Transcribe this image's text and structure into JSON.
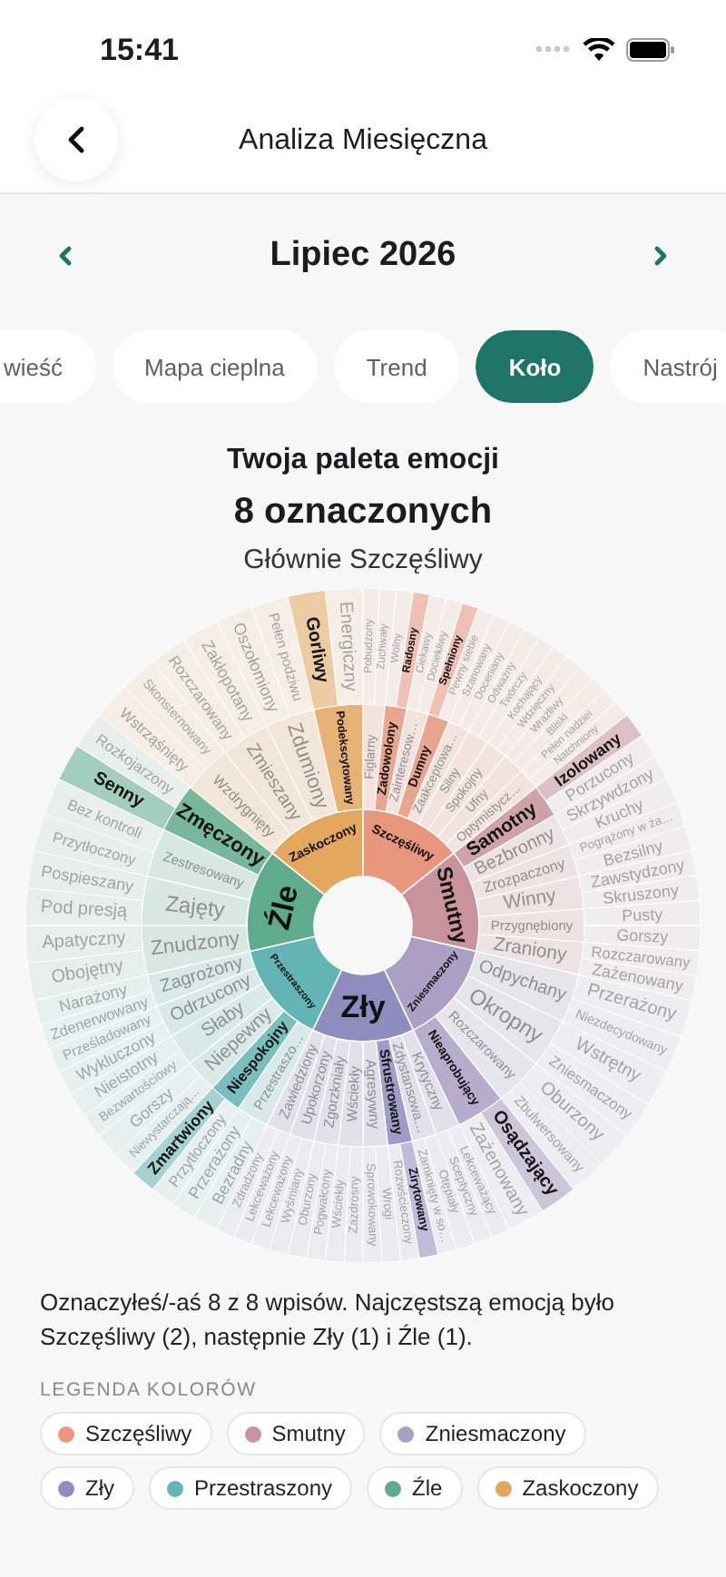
{
  "status_bar": {
    "time": "15:41"
  },
  "header": {
    "title": "Analiza Miesięczna"
  },
  "month": {
    "label": "Lipiec 2026"
  },
  "tabs": [
    {
      "label": "wieść",
      "selected": false
    },
    {
      "label": "Mapa cieplna",
      "selected": false
    },
    {
      "label": "Trend",
      "selected": false
    },
    {
      "label": "Koło",
      "selected": true
    },
    {
      "label": "Nastrój",
      "selected": false
    }
  ],
  "palette": {
    "title": "Twoja paleta emocji",
    "count": "8 oznaczonych",
    "subtitle": "Głównie Szczęśliwy"
  },
  "wheel": {
    "emotions": [
      {
        "name": "Zaskoczony",
        "color": "#e3a75e",
        "children": [
          {
            "name": "Wzdrygnięty",
            "highlighted": false,
            "children": [
              {
                "name": "Wstrząśnięty",
                "highlighted": false
              },
              {
                "name": "Skonsternowany",
                "highlighted": false
              }
            ]
          },
          {
            "name": "Zmieszany",
            "highlighted": false,
            "children": [
              {
                "name": "Rozczarowany",
                "highlighted": false
              },
              {
                "name": "Zakłopotany",
                "highlighted": false
              }
            ]
          },
          {
            "name": "Zdumiony",
            "highlighted": false,
            "children": [
              {
                "name": "Oszołomiony",
                "highlighted": false
              },
              {
                "name": "Pełen podziwu",
                "highlighted": false
              }
            ]
          },
          {
            "name": "Podekscytowany",
            "highlighted": true,
            "children": [
              {
                "name": "Gorliwy",
                "highlighted": true
              },
              {
                "name": "Energiczny",
                "highlighted": false
              }
            ]
          }
        ]
      },
      {
        "name": "Szczęśliwy",
        "color": "#e8967c",
        "children": [
          {
            "name": "Figlarny",
            "highlighted": false,
            "children": [
              {
                "name": "Pobudzony",
                "highlighted": false
              },
              {
                "name": "Zuchwały",
                "highlighted": false
              }
            ]
          },
          {
            "name": "Zadowolony",
            "highlighted": true,
            "children": [
              {
                "name": "Wolny",
                "highlighted": false
              },
              {
                "name": "Radosny",
                "highlighted": true
              }
            ]
          },
          {
            "name": "Zainteresow…",
            "highlighted": false,
            "children": [
              {
                "name": "Ciekawy",
                "highlighted": false
              },
              {
                "name": "Dociekliwy",
                "highlighted": false
              }
            ]
          },
          {
            "name": "Dumny",
            "highlighted": true,
            "children": [
              {
                "name": "Spełniony",
                "highlighted": true
              },
              {
                "name": "Pewny siebie",
                "highlighted": false
              }
            ]
          },
          {
            "name": "Zaakceptowa…",
            "highlighted": false,
            "children": [
              {
                "name": "Szanowany",
                "highlighted": false
              },
              {
                "name": "Doceniany",
                "highlighted": false
              }
            ]
          },
          {
            "name": "Silny",
            "highlighted": false,
            "children": [
              {
                "name": "Odważny",
                "highlighted": false
              },
              {
                "name": "Twórczy",
                "highlighted": false
              }
            ]
          },
          {
            "name": "Spokojny",
            "highlighted": false,
            "children": [
              {
                "name": "Kochający",
                "highlighted": false
              },
              {
                "name": "Wdzięczny",
                "highlighted": false
              }
            ]
          },
          {
            "name": "Ufny",
            "highlighted": false,
            "children": [
              {
                "name": "Wrażliwy",
                "highlighted": false
              },
              {
                "name": "Bliski",
                "highlighted": false
              }
            ]
          },
          {
            "name": "Optymistycz…",
            "highlighted": false,
            "children": [
              {
                "name": "Pełen nadziei",
                "highlighted": false
              },
              {
                "name": "Natchniony",
                "highlighted": false
              }
            ]
          }
        ]
      },
      {
        "name": "Smutny",
        "color": "#c8939c",
        "children": [
          {
            "name": "Samotny",
            "highlighted": true,
            "children": [
              {
                "name": "Izolowany",
                "highlighted": true
              },
              {
                "name": "Porzucony",
                "highlighted": false
              }
            ]
          },
          {
            "name": "Bezbronny",
            "highlighted": false,
            "children": [
              {
                "name": "Skrzywdzony",
                "highlighted": false
              },
              {
                "name": "Kruchy",
                "highlighted": false
              }
            ]
          },
          {
            "name": "Zrozpaczony",
            "highlighted": false,
            "children": [
              {
                "name": "Pogrążony w ża…",
                "highlighted": false
              },
              {
                "name": "Bezsilny",
                "highlighted": false
              }
            ]
          },
          {
            "name": "Winny",
            "highlighted": false,
            "children": [
              {
                "name": "Zawstydzony",
                "highlighted": false
              },
              {
                "name": "Skruszony",
                "highlighted": false
              }
            ]
          },
          {
            "name": "Przygnębiony",
            "highlighted": false,
            "children": [
              {
                "name": "Pusty",
                "highlighted": false
              },
              {
                "name": "Gorszy",
                "highlighted": false
              }
            ]
          },
          {
            "name": "Zraniony",
            "highlighted": false,
            "children": [
              {
                "name": "Rozczarowany",
                "highlighted": false
              },
              {
                "name": "Zażenowany",
                "highlighted": false
              }
            ]
          }
        ]
      },
      {
        "name": "Zniesmaczony",
        "color": "#ab9fc4",
        "children": [
          {
            "name": "Odpychany",
            "highlighted": false,
            "children": [
              {
                "name": "Przerażony",
                "highlighted": false
              },
              {
                "name": "Niezdecydowany",
                "highlighted": false
              }
            ]
          },
          {
            "name": "Okropny",
            "highlighted": false,
            "children": [
              {
                "name": "Wstrętny",
                "highlighted": false
              },
              {
                "name": "Zniesmaczony",
                "highlighted": false
              }
            ]
          },
          {
            "name": "Rozczarowany",
            "highlighted": false,
            "children": [
              {
                "name": "Oburzony",
                "highlighted": false
              },
              {
                "name": "Zbulwersowany",
                "highlighted": false
              }
            ]
          },
          {
            "name": "Nieaprobujący",
            "highlighted": true,
            "children": [
              {
                "name": "Osądzający",
                "highlighted": true
              },
              {
                "name": "Zażenowany",
                "highlighted": false
              }
            ]
          }
        ]
      },
      {
        "name": "Zły",
        "color": "#8f8cc0",
        "children": [
          {
            "name": "Krytyczny",
            "highlighted": false,
            "children": [
              {
                "name": "Lekceważący",
                "highlighted": false
              },
              {
                "name": "Sceptyczny",
                "highlighted": false
              }
            ]
          },
          {
            "name": "Zdystansowa…",
            "highlighted": false,
            "children": [
              {
                "name": "Otępiały",
                "highlighted": false
              },
              {
                "name": "Zamknięty w so…",
                "highlighted": false
              }
            ]
          },
          {
            "name": "Sfrustrowany",
            "highlighted": true,
            "children": [
              {
                "name": "Zirytowany",
                "highlighted": true
              },
              {
                "name": "Rozwścieczony",
                "highlighted": false
              }
            ]
          },
          {
            "name": "Agresywny",
            "highlighted": false,
            "children": [
              {
                "name": "Wrogi",
                "highlighted": false
              },
              {
                "name": "Sprowokowany",
                "highlighted": false
              }
            ]
          },
          {
            "name": "Wściekły",
            "highlighted": false,
            "children": [
              {
                "name": "Zazdrosny",
                "highlighted": false
              },
              {
                "name": "Wściekły",
                "highlighted": false
              }
            ]
          },
          {
            "name": "Zgorzkniały",
            "highlighted": false,
            "children": [
              {
                "name": "Pogwałcony",
                "highlighted": false
              },
              {
                "name": "Oburzony",
                "highlighted": false
              }
            ]
          },
          {
            "name": "Upokorzony",
            "highlighted": false,
            "children": [
              {
                "name": "Wyśmiany",
                "highlighted": false
              },
              {
                "name": "Lekceważony",
                "highlighted": false
              }
            ]
          },
          {
            "name": "Zawiedziony",
            "highlighted": false,
            "children": [
              {
                "name": "Lekceważony",
                "highlighted": false
              },
              {
                "name": "Zdradzony",
                "highlighted": false
              }
            ]
          }
        ]
      },
      {
        "name": "Przestraszony",
        "color": "#62b5b4",
        "children": [
          {
            "name": "Przestraszo…",
            "highlighted": false,
            "children": [
              {
                "name": "Bezradny",
                "highlighted": false
              },
              {
                "name": "Przerażony",
                "highlighted": false
              }
            ]
          },
          {
            "name": "Niespokojny",
            "highlighted": true,
            "children": [
              {
                "name": "Przytłoczony",
                "highlighted": false
              },
              {
                "name": "Zmartwiony",
                "highlighted": true
              }
            ]
          },
          {
            "name": "Niepewny",
            "highlighted": false,
            "children": [
              {
                "name": "Niewystarczają…",
                "highlighted": false
              },
              {
                "name": "Gorszy",
                "highlighted": false
              }
            ]
          },
          {
            "name": "Słaby",
            "highlighted": false,
            "children": [
              {
                "name": "Bezwartościowy",
                "highlighted": false
              },
              {
                "name": "Nieistotny",
                "highlighted": false
              }
            ]
          },
          {
            "name": "Odrzucony",
            "highlighted": false,
            "children": [
              {
                "name": "Wykluczony",
                "highlighted": false
              },
              {
                "name": "Prześladowany",
                "highlighted": false
              }
            ]
          },
          {
            "name": "Zagrożony",
            "highlighted": false,
            "children": [
              {
                "name": "Zdenerwowany",
                "highlighted": false
              },
              {
                "name": "Narażony",
                "highlighted": false
              }
            ]
          }
        ]
      },
      {
        "name": "Źle",
        "color": "#5fab8e",
        "children": [
          {
            "name": "Znudzony",
            "highlighted": false,
            "children": [
              {
                "name": "Obojętny",
                "highlighted": false
              },
              {
                "name": "Apatyczny",
                "highlighted": false
              }
            ]
          },
          {
            "name": "Zajęty",
            "highlighted": false,
            "children": [
              {
                "name": "Pod presją",
                "highlighted": false
              },
              {
                "name": "Pospieszany",
                "highlighted": false
              }
            ]
          },
          {
            "name": "Zestresowany",
            "highlighted": false,
            "children": [
              {
                "name": "Przytłoczony",
                "highlighted": false
              },
              {
                "name": "Bez kontroli",
                "highlighted": false
              }
            ]
          },
          {
            "name": "Zmęczony",
            "highlighted": true,
            "children": [
              {
                "name": "Senny",
                "highlighted": true
              },
              {
                "name": "Rozkojarzony",
                "highlighted": false
              }
            ]
          }
        ]
      }
    ]
  },
  "summary": "Oznaczyłeś/-aś 8 z 8 wpisów. Najczęstszą emocją było Szczęśliwy (2), następnie Zły (1) i Źle (1).",
  "legend": {
    "title": "LEGENDA KOLORÓW",
    "items": [
      {
        "label": "Szczęśliwy",
        "color": "#e8967c"
      },
      {
        "label": "Smutny",
        "color": "#c8939c"
      },
      {
        "label": "Zniesmaczony",
        "color": "#ab9fc4"
      },
      {
        "label": "Zły",
        "color": "#8f8cc0"
      },
      {
        "label": "Przestraszony",
        "color": "#62b5b4"
      },
      {
        "label": "Źle",
        "color": "#5fab8e"
      },
      {
        "label": "Zaskoczony",
        "color": "#e3a75e"
      }
    ]
  }
}
